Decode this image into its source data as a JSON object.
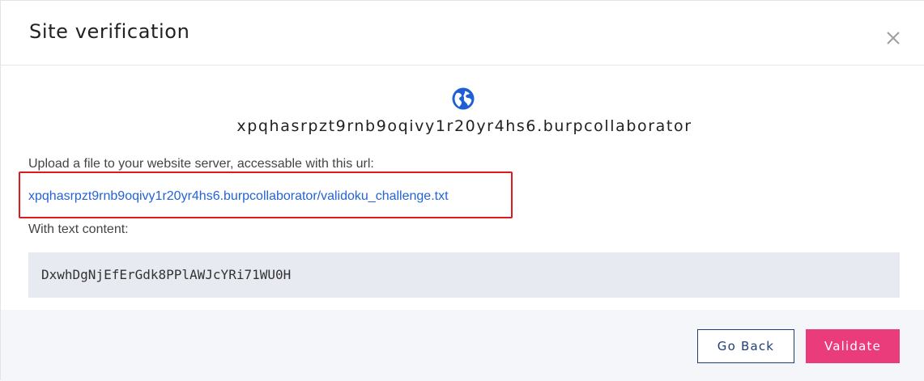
{
  "dialog": {
    "title": "Site verification",
    "close_icon": "close-icon"
  },
  "verification": {
    "globe_icon": "globe-icon",
    "domain": "xpqhasrpzt9rnb9oqivy1r20yr4hs6.burpcollaborator",
    "upload_instruction": "Upload a file to your website server, accessable with this url:",
    "file_url": "xpqhasrpzt9rnb9oqivy1r20yr4hs6.burpcollaborator/validoku_challenge.txt",
    "content_instruction": "With text content:",
    "file_content": "DxwhDgNjEfErGdk8PPlAWJcYRi71WU0H"
  },
  "footer": {
    "back_label": "Go Back",
    "validate_label": "Validate"
  },
  "colors": {
    "accent_blue": "#2563d8",
    "navy": "#1f3f77",
    "validate_pink": "#ea3b7a",
    "highlight_red": "#e0191f",
    "code_bg": "#e7eaf0",
    "footer_bg": "#f5f6f9"
  }
}
